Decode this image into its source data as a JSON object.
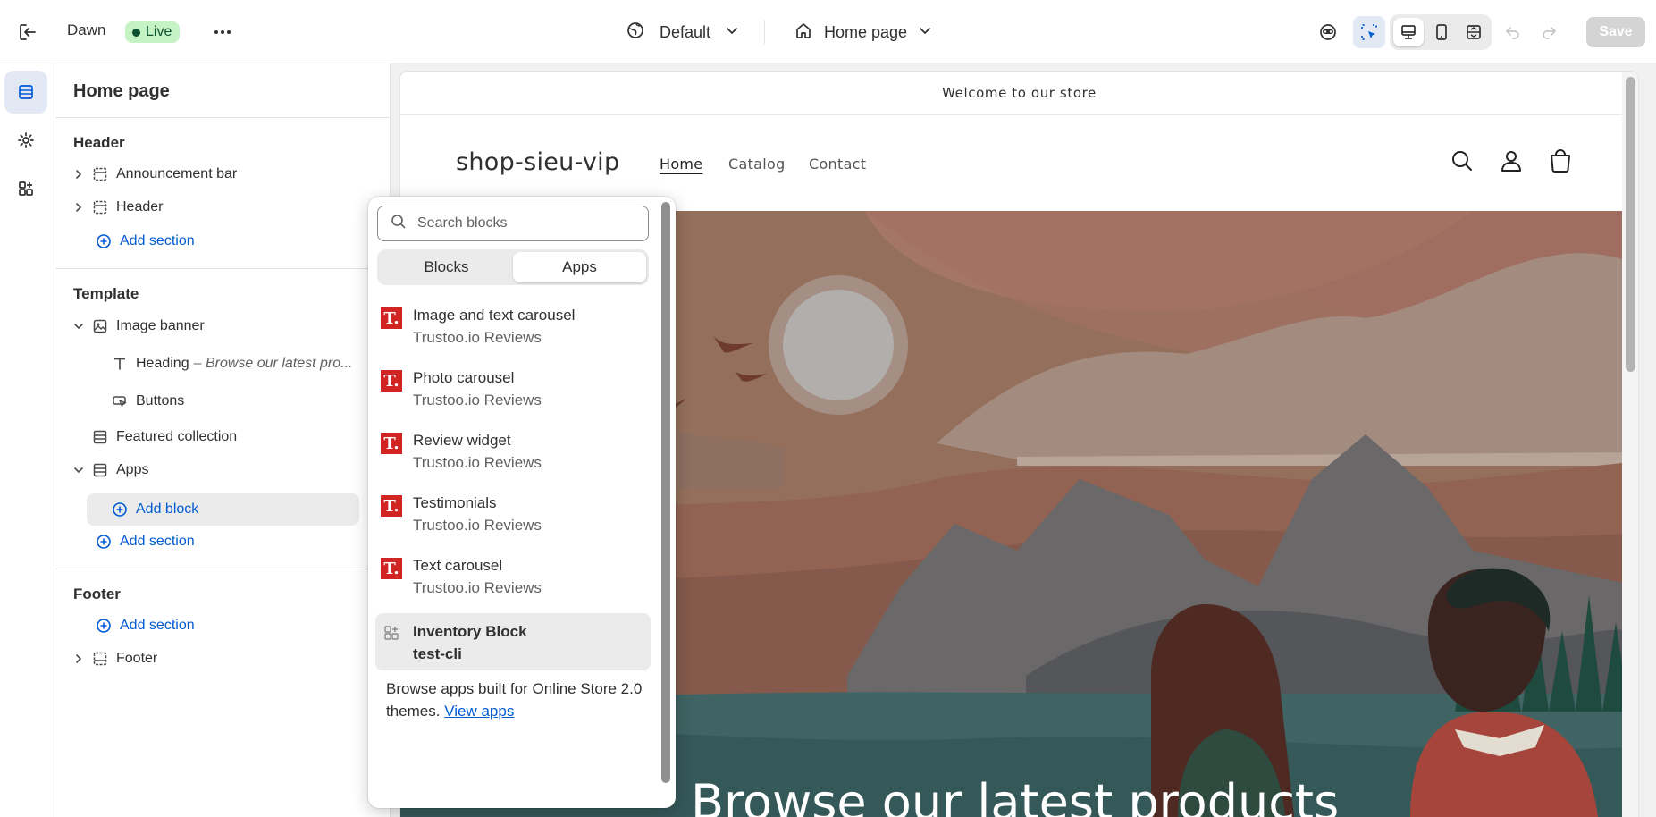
{
  "topbar": {
    "theme_name": "Dawn",
    "live_label": "Live",
    "market_label": "Default",
    "page_label": "Home page",
    "save_label": "Save"
  },
  "sidebar": {
    "title": "Home page",
    "header_group": "Header",
    "header_items": [
      "Announcement bar",
      "Header"
    ],
    "add_section": "Add section",
    "template_group": "Template",
    "image_banner": "Image banner",
    "heading_label": "Heading",
    "heading_sub": "– Browse our latest pro...",
    "buttons_label": "Buttons",
    "featured_collection": "Featured collection",
    "apps_label": "Apps",
    "add_block": "Add block",
    "footer_group": "Footer",
    "footer_item": "Footer"
  },
  "preview": {
    "announcement": "Welcome to our store",
    "logo": "shop-sieu-vip",
    "nav": [
      "Home",
      "Catalog",
      "Contact"
    ],
    "hero_title": "Browse our latest products"
  },
  "picker": {
    "search_placeholder": "Search blocks",
    "tabs": [
      "Blocks",
      "Apps"
    ],
    "active_tab": "Apps",
    "items": [
      {
        "name": "Image and text carousel",
        "app": "Trustoo.io Reviews"
      },
      {
        "name": "Photo carousel",
        "app": "Trustoo.io Reviews"
      },
      {
        "name": "Review widget",
        "app": "Trustoo.io Reviews"
      },
      {
        "name": "Testimonials",
        "app": "Trustoo.io Reviews"
      },
      {
        "name": "Text carousel",
        "app": "Trustoo.io Reviews"
      },
      {
        "name": "Inventory Block",
        "app": "test-cli"
      }
    ],
    "footer_text": "Browse apps built for Online Store 2.0 themes.",
    "footer_link": "View apps",
    "app_logo_letter": "T."
  },
  "colors": {
    "accent": "#005bd3",
    "live_bg": "#c6f3c6",
    "trustoo_red": "#d32424"
  }
}
